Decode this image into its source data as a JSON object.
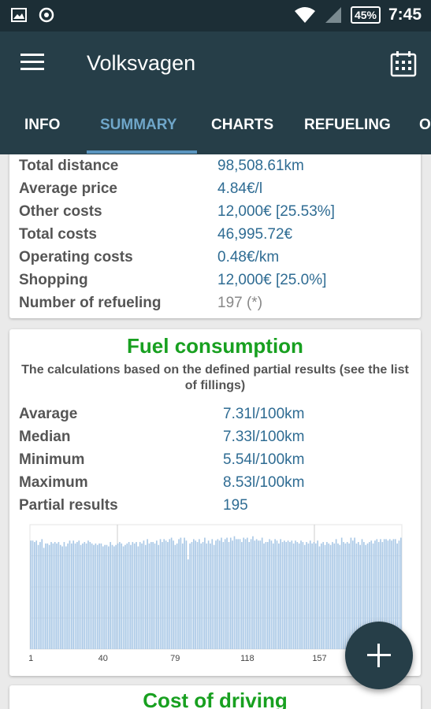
{
  "status_bar": {
    "battery": "45%",
    "time": "7:45"
  },
  "app_bar": {
    "title": "Volksvagen"
  },
  "tabs": [
    {
      "label": "INFO"
    },
    {
      "label": "SUMMARY",
      "active": true
    },
    {
      "label": "CHARTS"
    },
    {
      "label": "REFUELING"
    },
    {
      "label": "OT"
    }
  ],
  "summary": {
    "rows": [
      {
        "label": "Total distance",
        "value": "98,508.61km"
      },
      {
        "label": "Average price",
        "value": "4.84€/l"
      },
      {
        "label": "Other costs",
        "value": "12,000€ [25.53%]"
      },
      {
        "label": "Total costs",
        "value": "46,995.72€"
      },
      {
        "label": "Operating costs",
        "value": "0.48€/km"
      },
      {
        "label": "Shopping",
        "value": "12,000€ [25.0%]"
      },
      {
        "label": "Number of refueling",
        "value": "197 (*)"
      }
    ]
  },
  "fuel": {
    "title": "Fuel consumption",
    "note": "The calculations based on the defined partial results (see the list of fillings)",
    "rows": [
      {
        "label": "Avarage",
        "value": "7.31l/100km"
      },
      {
        "label": "Median",
        "value": "7.33l/100km"
      },
      {
        "label": "Minimum",
        "value": "5.54l/100km"
      },
      {
        "label": "Maximum",
        "value": "8.53l/100km"
      },
      {
        "label": "Partial results",
        "value": "195"
      }
    ]
  },
  "cost": {
    "title": "Cost of driving"
  },
  "colors": {
    "accent": "#5a95bf",
    "bar": "#a9c8e6",
    "title_green": "#18a020",
    "appbar": "#263e48"
  },
  "chart_data": {
    "type": "bar",
    "x_tick_labels": [
      "1",
      "40",
      "79",
      "118",
      "157"
    ],
    "n_bars": 195,
    "values_note": "fuel consumption per partial result, l/100km",
    "values": [
      7.5,
      7.5,
      7.4,
      7.5,
      7.2,
      7.4,
      7.6,
      7.0,
      7.3,
      7.3,
      7.2,
      7.4,
      7.3,
      7.4,
      7.3,
      7.4,
      7.2,
      7.1,
      7.4,
      7.1,
      7.3,
      7.5,
      7.3,
      7.5,
      7.3,
      7.4,
      7.5,
      7.2,
      7.3,
      7.4,
      7.3,
      7.5,
      7.4,
      7.3,
      7.2,
      7.3,
      7.2,
      7.3,
      7.3,
      7.1,
      7.2,
      7.2,
      7.1,
      7.4,
      7.2,
      7.1,
      7.2,
      7.3,
      7.4,
      7.3,
      7.1,
      7.2,
      7.3,
      7.4,
      7.2,
      7.4,
      7.3,
      7.4,
      7.1,
      7.4,
      7.3,
      7.5,
      7.2,
      7.6,
      7.3,
      7.4,
      7.4,
      7.3,
      7.5,
      7.2,
      7.6,
      7.4,
      7.6,
      7.5,
      7.4,
      7.6,
      7.7,
      7.5,
      7.2,
      7.3,
      7.6,
      7.7,
      7.3,
      7.7,
      7.5,
      6.2,
      7.3,
      7.4,
      7.6,
      7.5,
      7.4,
      7.6,
      7.3,
      7.4,
      7.7,
      7.3,
      7.5,
      7.3,
      7.6,
      7.2,
      7.5,
      7.6,
      7.5,
      7.7,
      7.4,
      7.6,
      7.7,
      7.4,
      7.7,
      7.5,
      7.8,
      7.6,
      7.6,
      7.6,
      7.4,
      7.7,
      7.6,
      7.7,
      7.4,
      7.6,
      7.8,
      7.5,
      7.6,
      7.5,
      7.5,
      7.7,
      7.3,
      7.4,
      7.4,
      7.6,
      7.5,
      7.3,
      7.6,
      7.5,
      7.3,
      7.6,
      7.4,
      7.5,
      7.4,
      7.5,
      7.4,
      7.5,
      7.3,
      7.5,
      7.4,
      7.3,
      7.5,
      7.4,
      7.2,
      7.4,
      7.3,
      7.5,
      7.3,
      7.4,
      7.3,
      7.5,
      7.1,
      7.3,
      7.4,
      7.2,
      7.4,
      7.3,
      7.2,
      7.4,
      7.3,
      7.6,
      7.3,
      7.2,
      7.7,
      7.4,
      7.3,
      7.4,
      7.3,
      7.7,
      7.5,
      7.7,
      7.3,
      7.4,
      7.2,
      7.6,
      7.4,
      7.2,
      7.3,
      7.4,
      7.5,
      7.3,
      7.5,
      7.6,
      7.4,
      7.6,
      7.4,
      7.6,
      7.6,
      7.5,
      7.6,
      7.5,
      7.6,
      7.6,
      7.3,
      7.5,
      7.7
    ],
    "ylim": [
      0,
      8.6
    ],
    "grid": true
  }
}
